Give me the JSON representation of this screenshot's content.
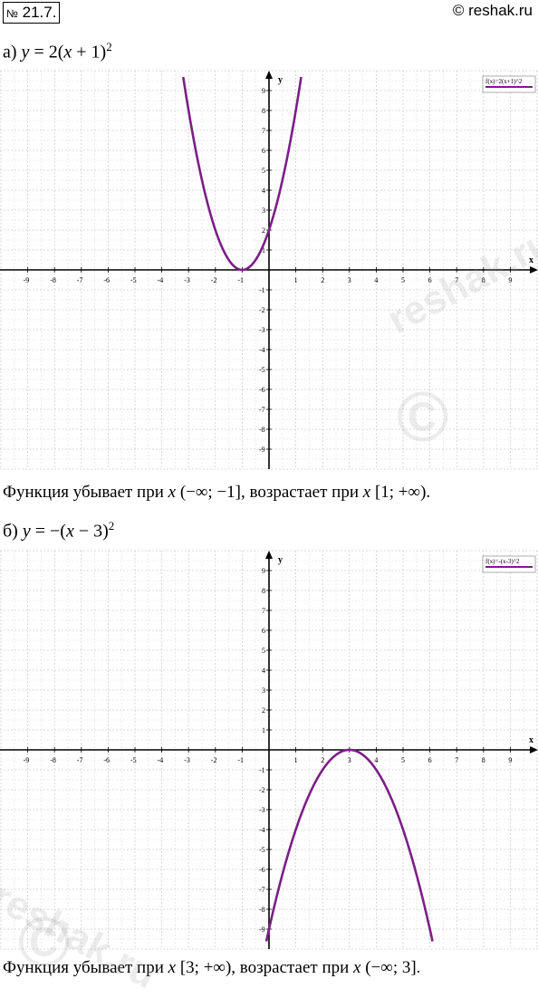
{
  "header": {
    "task_no_sign": "№",
    "task_number": "21.7.",
    "site": "© reshak.ru"
  },
  "part_a": {
    "prefix": "а)",
    "equation": {
      "lhs": "y",
      "eq": " = 2(",
      "var": "x",
      "rest": " + 1)",
      "power": "2"
    },
    "conclusion": {
      "text1": "Функция убывает при ",
      "var1": "x",
      "interval1": " (−∞;  −1], возрастает при ",
      "var2": "x",
      "interval2": " [1; +∞)."
    }
  },
  "part_b": {
    "prefix": "б)",
    "equation": {
      "lhs": "y",
      "eq": " = −(",
      "var": "x",
      "rest": " − 3)",
      "power": "2"
    },
    "conclusion": {
      "text1": "Функция убывает при ",
      "var1": "x",
      "interval1": " [3; +∞), возрастает при ",
      "var2": "x",
      "interval2": " (−∞; 3]."
    }
  },
  "watermarks": {
    "text": "reshak.ru",
    "copyright": "©"
  },
  "chart_data": [
    {
      "type": "line",
      "function": "2*(x+1)^2",
      "legend": "f(x)=2(x+1)^2",
      "legend_placement": "top-right",
      "xlabel": "x",
      "ylabel": "y",
      "xlim": [
        -10,
        10
      ],
      "ylim": [
        -10,
        10
      ],
      "x_ticks": [
        -9,
        -8,
        -7,
        -6,
        -5,
        -4,
        -3,
        -2,
        -1,
        1,
        2,
        3,
        4,
        5,
        6,
        7,
        8,
        9
      ],
      "y_ticks": [
        -9,
        -8,
        -7,
        -6,
        -5,
        -4,
        -3,
        -2,
        -1,
        1,
        2,
        3,
        4,
        5,
        6,
        7,
        8,
        9
      ],
      "grid": true,
      "color": "#7b1f86",
      "series": [
        {
          "x": [
            -3.2,
            -3,
            -2.5,
            -2,
            -1.5,
            -1,
            -0.5,
            0,
            0.5,
            1,
            1.2
          ],
          "y": [
            9.68,
            8,
            4.5,
            2,
            0.5,
            0,
            0.5,
            2,
            4.5,
            8,
            9.68
          ]
        }
      ]
    },
    {
      "type": "line",
      "function": "-(x-3)^2",
      "legend": "f(x)=-(x-3)^2",
      "legend_placement": "top-right",
      "xlabel": "x",
      "ylabel": "y",
      "xlim": [
        -10,
        10
      ],
      "ylim": [
        -10,
        10
      ],
      "x_ticks": [
        -9,
        -8,
        -7,
        -6,
        -5,
        -4,
        -3,
        -2,
        -1,
        1,
        2,
        3,
        4,
        5,
        6,
        7,
        8,
        9
      ],
      "y_ticks": [
        -9,
        -8,
        -7,
        -6,
        -5,
        -4,
        -3,
        -2,
        -1,
        1,
        2,
        3,
        4,
        5,
        6,
        7,
        8,
        9
      ],
      "grid": true,
      "color": "#7b1f86",
      "series": [
        {
          "x": [
            -0.1,
            0,
            1,
            2,
            3,
            4,
            5,
            6,
            6.1
          ],
          "y": [
            -9.61,
            -9,
            -4,
            -1,
            0,
            -1,
            -4,
            -9,
            -9.61
          ]
        }
      ]
    }
  ]
}
